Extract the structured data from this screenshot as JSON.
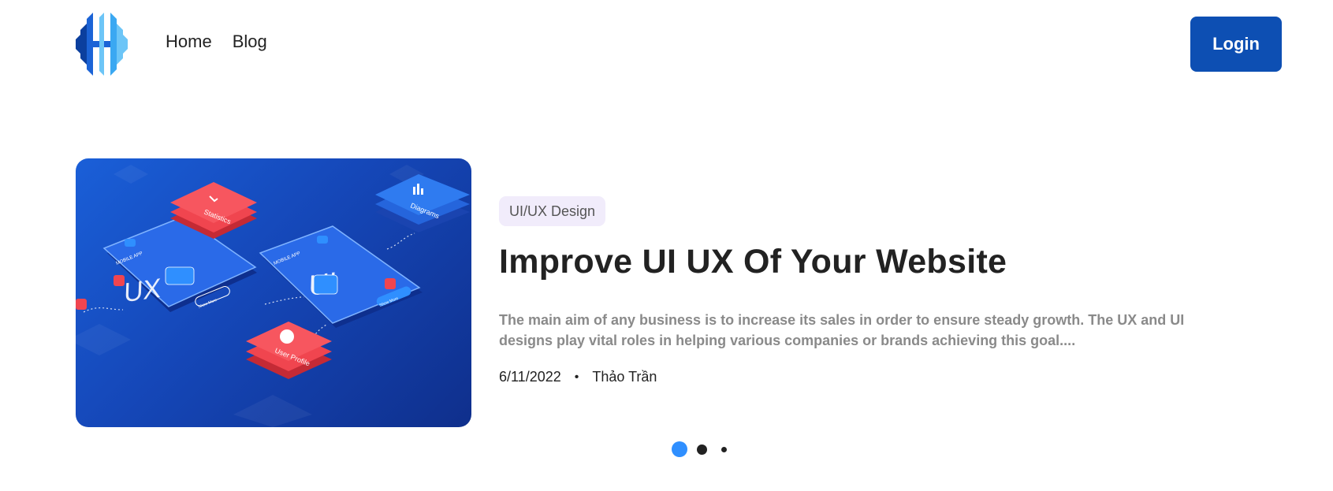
{
  "header": {
    "logo_name": "hh-logo",
    "nav": [
      {
        "label": "Home"
      },
      {
        "label": "Blog"
      }
    ],
    "login_label": "Login"
  },
  "slide": {
    "image_icon": "isometric-ui-ux-illustration",
    "illustration_text": {
      "phone_left": "MOBILE APP",
      "phone_left_big": "UX",
      "phone_right": "MOBILE APP",
      "phone_right_big": "UI",
      "card_statistics": "Statistics",
      "card_diagrams": "Diagrams",
      "card_user_profile": "User Profile",
      "btn_left": "Show More",
      "btn_right": "Show More"
    },
    "tag": "UI/UX Design",
    "title": "Improve UI UX Of Your Website",
    "excerpt": "The main aim of any business is to increase its sales in order to ensure steady growth. The UX and UI designs play vital roles in helping various companies or brands achieving this goal....",
    "date": "6/11/2022",
    "separator": "•",
    "author": "Thảo Trần"
  },
  "carousel": {
    "slide_count": 3,
    "active_index": 0
  },
  "colors": {
    "primary": "#0d4fb3",
    "dot_active": "#2f8fff",
    "tag_bg": "#f1ecfb",
    "card_red": "#f0454f"
  }
}
